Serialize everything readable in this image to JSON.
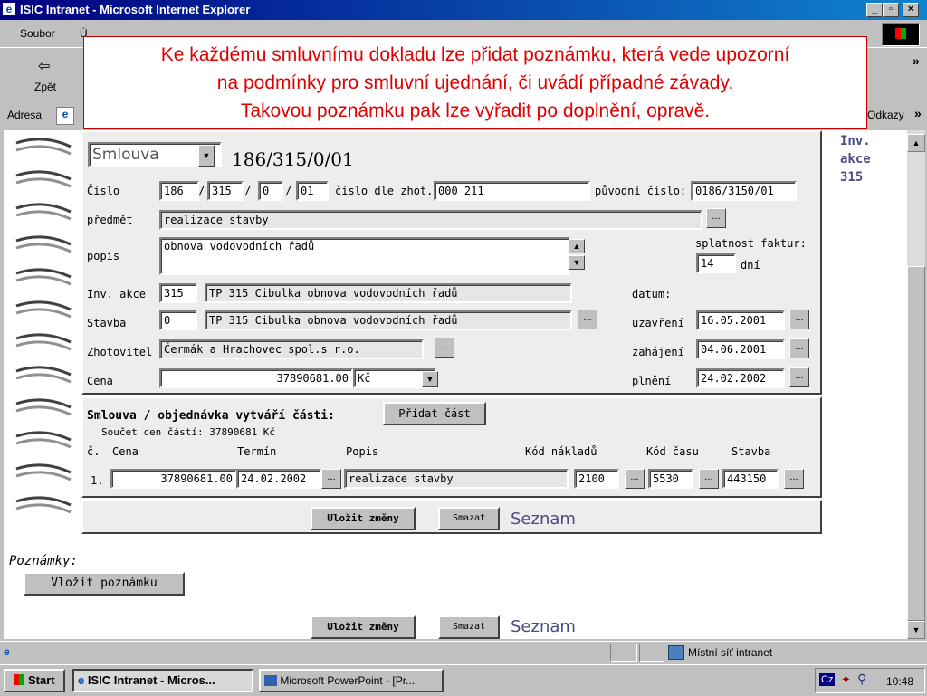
{
  "window": {
    "title": "ISIC Intranet - Microsoft Internet Explorer"
  },
  "menu": {
    "soubor": "Soubor",
    "u": "Ú",
    "odkazy": "Odkazy",
    "chev": "»"
  },
  "toolbar": {
    "back": "Zpět",
    "address": "Adresa"
  },
  "callout": {
    "line1": "Ke každému smluvnímu dokladu lze přidat poznámku, která vede upozorní",
    "line2": "na podmínky pro smluvní ujednání, či uvádí případné závady.",
    "line3": "Takovou poznámku pak lze vyřadit po doplnění, opravě."
  },
  "side": {
    "l1": "Inv.",
    "l2": "akce",
    "l3": "315"
  },
  "contract": {
    "type": "Smlouva",
    "number_display": "186/315/0/01",
    "cislo_label": "Číslo",
    "cislo_parts": [
      "186",
      "315",
      "0",
      "01"
    ],
    "slash": "/",
    "zhot_label": "číslo dle zhot.:",
    "zhot_value": "000 211",
    "puvodni_label": "původní číslo:",
    "puvodni_value": "0186/3150/01",
    "predmet_label": "předmět",
    "predmet_value": "realizace stavby",
    "popis_label": "popis",
    "popis_value": "obnova vodovodních řadů",
    "splatnost_label": "splatnost faktur:",
    "splatnost_value": "14",
    "dni": "dní",
    "inv_label": "Inv. akce",
    "inv_code": "315",
    "inv_name": "TP 315 Cibulka obnova vodovodních řadů",
    "stavba_label": "Stavba",
    "stavba_code": "0",
    "stavba_name": "TP 315 Cibulka obnova vodovodních řadů",
    "zhotovitel_label": "Zhotovitel",
    "zhotovitel_value": "Čermák a Hrachovec spol.s r.o.",
    "cena_label": "Cena",
    "cena_value": "37890681.00",
    "currency": "Kč",
    "datum_label": "datum:",
    "uzavreni_label": "uzavření",
    "uzavreni_value": "16.05.2001",
    "zahajeni_label": "zahájení",
    "zahajeni_value": "04.06.2001",
    "plneni_label": "plnění",
    "plneni_value": "24.02.2002"
  },
  "parts": {
    "heading": "Smlouva / objednávka vytváří části:",
    "add_button": "Přidat část",
    "sum": "Součet cen částí: 37890681 Kč",
    "headers": [
      "č.",
      "Cena",
      "Termín",
      "Popis",
      "Kód nákladů",
      "Kód času",
      "Stavba"
    ],
    "row": {
      "no": "1.",
      "cena": "37890681.00",
      "termin": "24.02.2002",
      "popis": "realizace stavby",
      "kod_nakladu": "2100",
      "kod_casu": "5530",
      "stavba": "443150"
    }
  },
  "actions": {
    "save": "Uložit změny",
    "delete": "Smazat",
    "list": "Seznam",
    "dots": "..."
  },
  "notes": {
    "label": "Poznámky:",
    "add_button": "Vložit poznámku"
  },
  "status": {
    "zone": "Místní síť intranet"
  },
  "taskbar": {
    "start": "Start",
    "task1": "ISIC Intranet - Micros...",
    "task2": "Microsoft PowerPoint - [Pr...",
    "lang": "Cz",
    "time": "10:48"
  }
}
